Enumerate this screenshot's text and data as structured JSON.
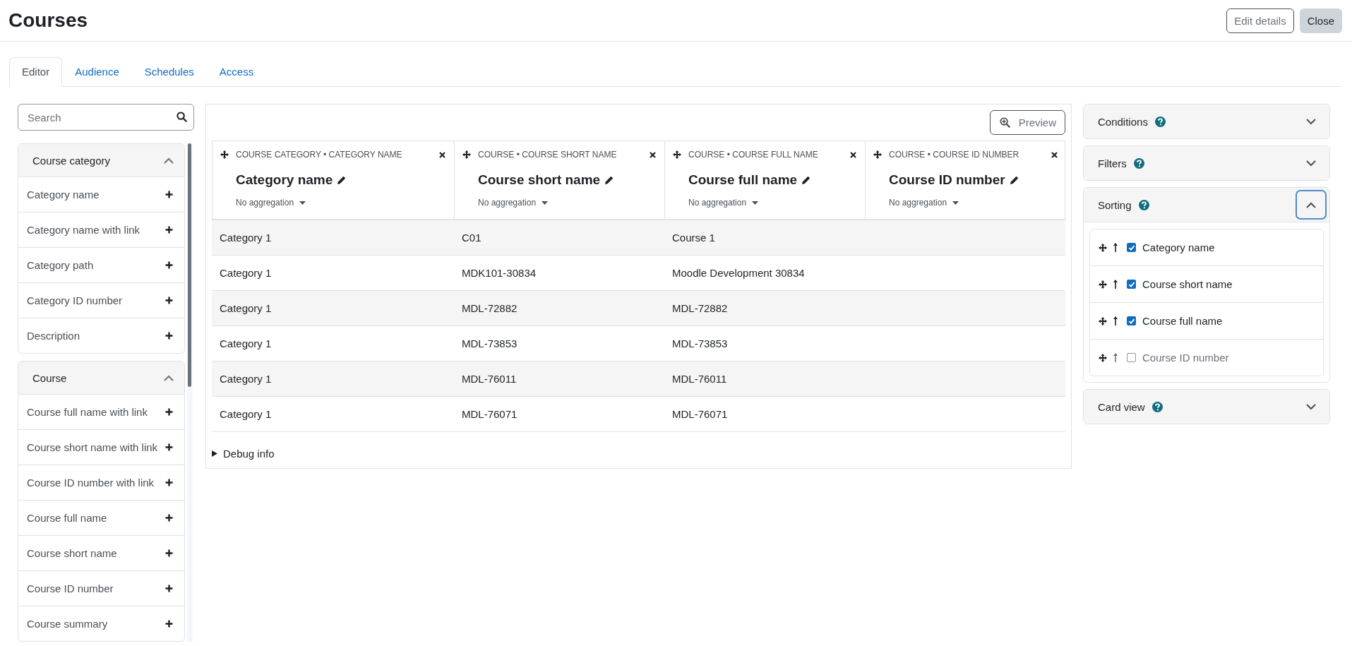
{
  "page": {
    "title": "Courses",
    "buttons": [
      {
        "label": "Edit details",
        "kind": "outline"
      },
      {
        "label": "Close",
        "kind": "secondary"
      }
    ]
  },
  "tabs": [
    {
      "label": "Editor",
      "selected": true
    },
    {
      "label": "Audience",
      "selected": false
    },
    {
      "label": "Schedules",
      "selected": false
    },
    {
      "label": "Access",
      "selected": false
    }
  ],
  "sidebar": {
    "search": {
      "placeholder": "Search"
    },
    "groups": [
      {
        "title": "Course category",
        "expanded": true,
        "items": [
          "Category name",
          "Category name with link",
          "Category path",
          "Category ID number",
          "Description"
        ]
      },
      {
        "title": "Course",
        "expanded": true,
        "items": [
          "Course full name with link",
          "Course short name with link",
          "Course ID number with link",
          "Course full name",
          "Course short name",
          "Course ID number",
          "Course summary"
        ]
      }
    ]
  },
  "preview_button": {
    "label": "Preview"
  },
  "table": {
    "columns": [
      {
        "source": "COURSE CATEGORY • CATEGORY NAME",
        "heading": "Category name",
        "aggregation": "No aggregation"
      },
      {
        "source": "COURSE • COURSE SHORT NAME",
        "heading": "Course short name",
        "aggregation": "No aggregation"
      },
      {
        "source": "COURSE • COURSE FULL NAME",
        "heading": "Course full name",
        "aggregation": "No aggregation"
      },
      {
        "source": "COURSE • COURSE ID NUMBER",
        "heading": "Course ID number",
        "aggregation": "No aggregation"
      }
    ],
    "rows": [
      [
        "Category 1",
        "C01",
        "Course 1",
        ""
      ],
      [
        "Category 1",
        "MDK101-30834",
        "Moodle Development 30834",
        ""
      ],
      [
        "Category 1",
        "MDL-72882",
        "MDL-72882",
        ""
      ],
      [
        "Category 1",
        "MDL-73853",
        "MDL-73853",
        ""
      ],
      [
        "Category 1",
        "MDL-76011",
        "MDL-76011",
        ""
      ],
      [
        "Category 1",
        "MDL-76071",
        "MDL-76071",
        ""
      ]
    ]
  },
  "debug": {
    "label": "Debug info",
    "expanded": false
  },
  "settings": [
    {
      "title": "Conditions",
      "expanded": false,
      "focused": false
    },
    {
      "title": "Filters",
      "expanded": false,
      "focused": false
    },
    {
      "title": "Sorting",
      "expanded": true,
      "focused": true,
      "items": [
        {
          "label": "Category name",
          "checked": true
        },
        {
          "label": "Course short name",
          "checked": true
        },
        {
          "label": "Course full name",
          "checked": true
        },
        {
          "label": "Course ID number",
          "checked": false
        }
      ]
    },
    {
      "title": "Card view",
      "expanded": false,
      "focused": false
    }
  ]
}
